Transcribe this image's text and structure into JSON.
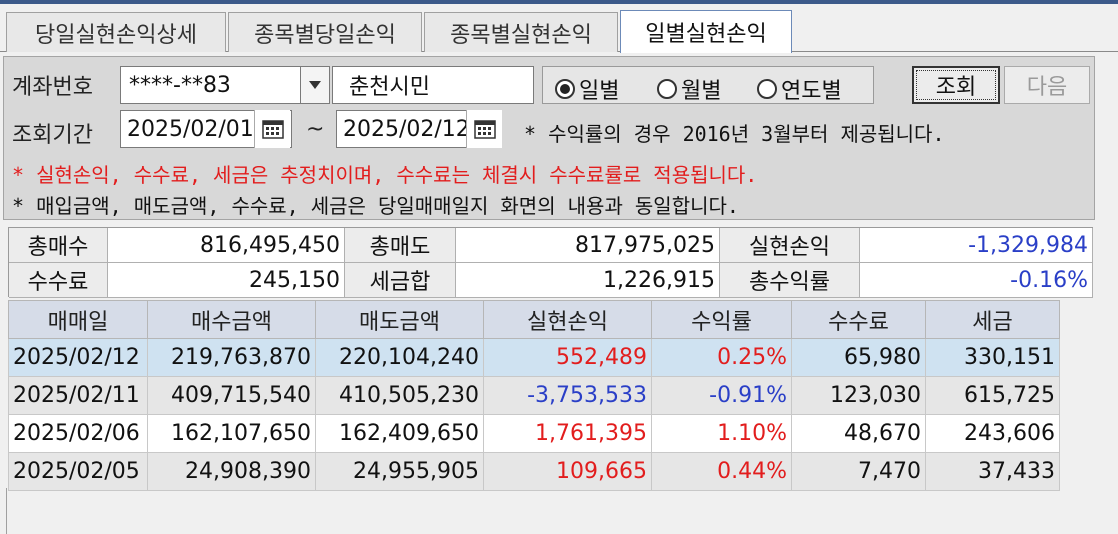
{
  "tabs": [
    {
      "label": "당일실현손익상세"
    },
    {
      "label": "종목별당일손익"
    },
    {
      "label": "종목별실현손익"
    },
    {
      "label": "일별실현손익"
    }
  ],
  "form": {
    "account_label": "계좌번호",
    "account_value": "****-**83",
    "account_name": "춘천시민",
    "radios": [
      {
        "label": "일별",
        "selected": true
      },
      {
        "label": "월별",
        "selected": false
      },
      {
        "label": "연도별",
        "selected": false
      }
    ],
    "query_button": "조회",
    "next_button": "다음",
    "period_label": "조회기간",
    "date_from": "2025/02/01",
    "tilde": "~",
    "date_to": "2025/02/12",
    "notice_yield": "* 수익률의 경우 2016년 3월부터 제공됩니다.",
    "notice_red": "* 실현손익, 수수료, 세금은 추정치이며, 수수료는 체결시 수수료률로 적용됩니다.",
    "notice_black": "* 매입금액, 매도금액, 수수료, 세금은 당일매매일지 화면의 내용과 동일합니다."
  },
  "summary": {
    "total_buy_label": "총매수",
    "total_buy": "816,495,450",
    "total_sell_label": "총매도",
    "total_sell": "817,975,025",
    "realized_label": "실현손익",
    "realized": "-1,329,984",
    "fee_label": "수수료",
    "fee": "245,150",
    "tax_label": "세금합",
    "tax": "1,226,915",
    "yield_label": "총수익률",
    "yield": "-0.16%"
  },
  "table": {
    "headers": [
      "매매일",
      "매수금액",
      "매도금액",
      "실현손익",
      "수익률",
      "수수료",
      "세금"
    ],
    "rows": [
      {
        "date": "2025/02/12",
        "buy": "219,763,870",
        "sell": "220,104,240",
        "pnl": "552,489",
        "rate": "0.25%",
        "fee": "65,980",
        "tax": "330,151"
      },
      {
        "date": "2025/02/11",
        "buy": "409,715,540",
        "sell": "410,505,230",
        "pnl": "-3,753,533",
        "rate": "-0.91%",
        "fee": "123,030",
        "tax": "615,725"
      },
      {
        "date": "2025/02/06",
        "buy": "162,107,650",
        "sell": "162,409,650",
        "pnl": "1,761,395",
        "rate": "1.10%",
        "fee": "48,670",
        "tax": "243,606"
      },
      {
        "date": "2025/02/05",
        "buy": "24,908,390",
        "sell": "24,955,905",
        "pnl": "109,665",
        "rate": "0.44%",
        "fee": "7,470",
        "tax": "37,433"
      }
    ]
  },
  "colors": {
    "positive": "#e21d1d",
    "negative": "#2a3fc7",
    "selected_row": "#cfe2f1",
    "header": "#d6dce8"
  }
}
